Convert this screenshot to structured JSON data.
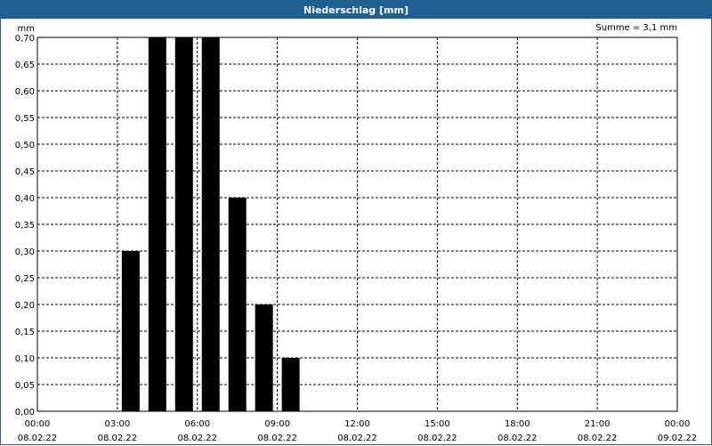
{
  "window": {
    "title": "Niederschlag [mm]"
  },
  "chart_data": {
    "type": "bar",
    "title": "Niederschlag [mm]",
    "ylabel": "mm",
    "annotation": "Summe = 3,1 mm",
    "ylim": [
      0,
      0.7
    ],
    "xlim_hours": [
      0,
      24
    ],
    "y_ticks": [
      "0,00",
      "0,05",
      "0,10",
      "0,15",
      "0,20",
      "0,25",
      "0,30",
      "0,35",
      "0,40",
      "0,45",
      "0,50",
      "0,55",
      "0,60",
      "0,65",
      "0,70"
    ],
    "x_ticks": [
      {
        "time": "00:00",
        "date": "08.02.22"
      },
      {
        "time": "03:00",
        "date": "08.02.22"
      },
      {
        "time": "06:00",
        "date": "08.02.22"
      },
      {
        "time": "09:00",
        "date": "08.02.22"
      },
      {
        "time": "12:00",
        "date": "08.02.22"
      },
      {
        "time": "15:00",
        "date": "08.02.22"
      },
      {
        "time": "18:00",
        "date": "08.02.22"
      },
      {
        "time": "21:00",
        "date": "08.02.22"
      },
      {
        "time": "00:00",
        "date": "09.02.22"
      }
    ],
    "bars": [
      {
        "hour": 3,
        "value": 0.3
      },
      {
        "hour": 4,
        "value": 0.7
      },
      {
        "hour": 5,
        "value": 0.7
      },
      {
        "hour": 6,
        "value": 0.7
      },
      {
        "hour": 7,
        "value": 0.4
      },
      {
        "hour": 8,
        "value": 0.2
      },
      {
        "hour": 9,
        "value": 0.1
      }
    ],
    "grid": true,
    "bar_color": "#000000"
  }
}
